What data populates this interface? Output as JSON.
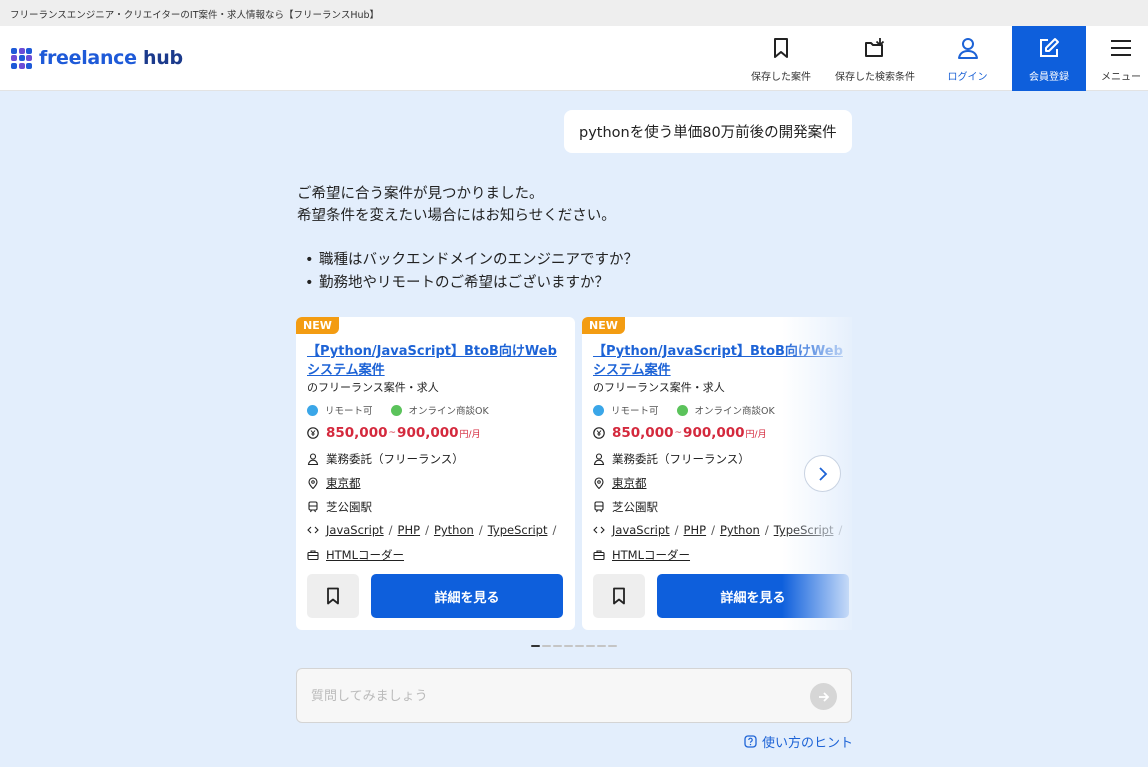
{
  "page_title": "フリーランスエンジニア・クリエイターのIT案件・求人情報なら【フリーランスHub】",
  "logo": {
    "text_main": "freelance",
    "text_sub": "hub"
  },
  "nav": {
    "saved_jobs": "保存した案件",
    "saved_search": "保存した検索条件",
    "login": "ログイン",
    "register": "会員登録",
    "menu": "メニュー"
  },
  "chat": {
    "user_message": "pythonを使う単価80万前後の開発案件",
    "reply_line1": "ご希望に合う案件が見つかりました。",
    "reply_line2": "希望条件を変えたい場合にはお知らせください。",
    "questions": [
      "職種はバックエンドメインのエンジニアですか？",
      "勤務地やリモートのご希望はございますか？"
    ]
  },
  "cards": [
    {
      "badge": "NEW",
      "title": "【Python/JavaScript】BtoB向けWebシステム案件",
      "subtitle": "のフリーランス案件・求人",
      "tag_remote": "リモート可",
      "tag_online": "オンライン商談OK",
      "price_min": "850,000",
      "price_tilde": "~",
      "price_max": "900,000",
      "price_unit": "円/月",
      "contract": "業務委託（フリーランス）",
      "location": "東京都",
      "station": "芝公園駅",
      "skills": [
        "JavaScript",
        "PHP",
        "Python",
        "TypeScript"
      ],
      "skill_sep": "/",
      "job_type": "HTMLコーダー",
      "detail_label": "詳細を見る"
    },
    {
      "badge": "NEW",
      "title": "【Python/JavaScript】BtoB向けWebシステム案件",
      "subtitle": "のフリーランス案件・求人",
      "tag_remote": "リモート可",
      "tag_online": "オンライン商談OK",
      "price_min": "850,000",
      "price_tilde": "~",
      "price_max": "900,000",
      "price_unit": "円/月",
      "contract": "業務委託（フリーランス）",
      "location": "東京都",
      "station": "芝公園駅",
      "skills": [
        "JavaScript",
        "PHP",
        "Python",
        "TypeScript"
      ],
      "skill_sep": "/",
      "job_type": "HTMLコーダー",
      "detail_label": "詳細を見る"
    }
  ],
  "pagination": {
    "total": 8,
    "active": 0
  },
  "input": {
    "placeholder": "質問してみましょう",
    "value": ""
  },
  "hint": "使い方のヒント",
  "colors": {
    "brand_blue": "#0e5fdc",
    "link_blue": "#1d63d6",
    "price_red": "#d4293d",
    "badge_orange": "#f39c12",
    "page_bg": "#e3eefc"
  }
}
